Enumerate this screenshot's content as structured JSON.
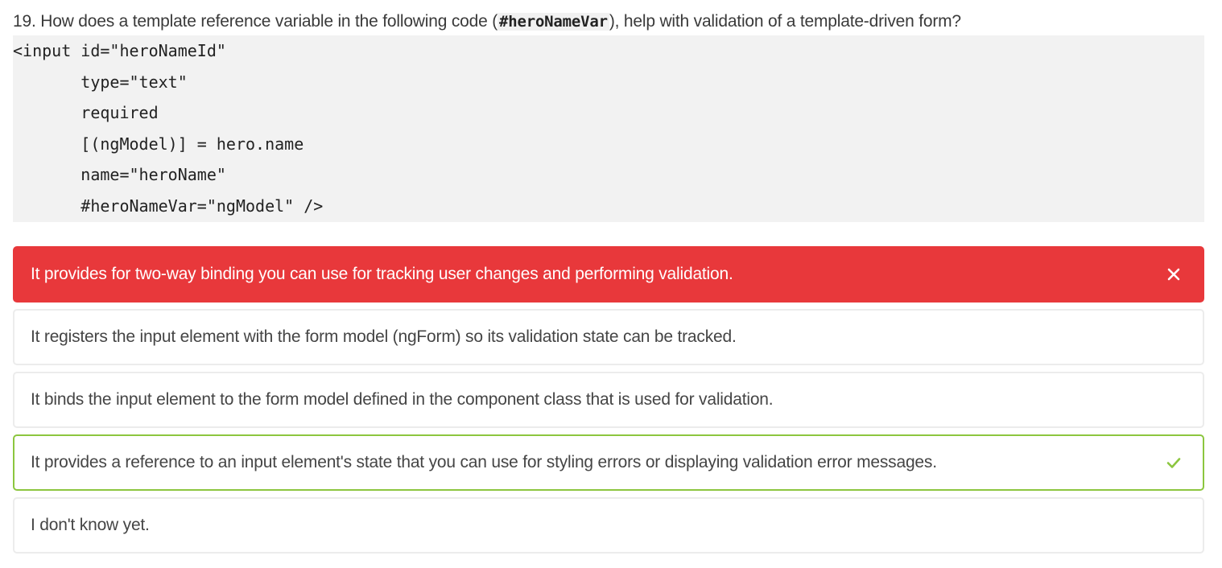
{
  "question": {
    "prefix": "19. How does a template reference variable in the following code (",
    "code_ref": "#heroNameVar",
    "suffix": "), help with validation of a template-driven form?"
  },
  "code_lines": [
    "<input id=\"heroNameId\"",
    "       type=\"text\"",
    "       required",
    "       [(ngModel)] = hero.name",
    "       name=\"heroName\"",
    "       #heroNameVar=\"ngModel\" />"
  ],
  "options": [
    {
      "text": "It provides for two-way binding you can use for tracking user changes and performing validation.",
      "state": "incorrect",
      "icon": "close-icon"
    },
    {
      "text": "It registers the input element with the form model (ngForm) so its validation state can be tracked.",
      "state": "neutral"
    },
    {
      "text": "It binds the input element to the form model defined in the component class that is used for validation.",
      "state": "neutral"
    },
    {
      "text": "It provides a reference to an input element's state that you can use for styling errors or displaying validation error messages.",
      "state": "correct",
      "icon": "check-icon"
    },
    {
      "text": "I don't know yet.",
      "state": "neutral"
    }
  ],
  "colors": {
    "incorrect": "#e8383b",
    "correct": "#8cc63f",
    "code_background": "#f2f2f2"
  }
}
